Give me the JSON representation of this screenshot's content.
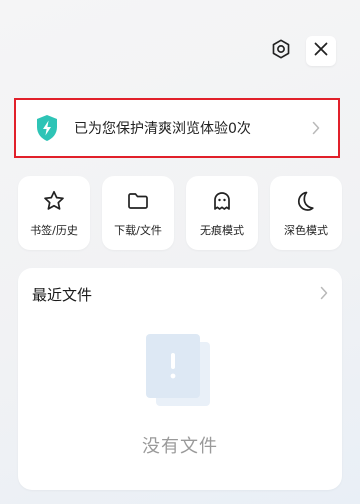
{
  "header": {
    "settings_icon": "settings-hexagon-icon",
    "close_icon": "close-icon"
  },
  "protection_banner": {
    "text": "已为您保护清爽浏览体验0次",
    "icon": "shield-lightning-icon",
    "accent_color": "#2ec4b6",
    "highlight_border_color": "#e1202a"
  },
  "quick_actions": [
    {
      "label": "书签/历史",
      "icon": "star-icon"
    },
    {
      "label": "下载/文件",
      "icon": "folder-icon"
    },
    {
      "label": "无痕模式",
      "icon": "ghost-icon"
    },
    {
      "label": "深色模式",
      "icon": "moon-icon"
    }
  ],
  "recent_files": {
    "title": "最近文件",
    "empty_text": "没有文件",
    "empty_icon": "empty-file-icon"
  }
}
